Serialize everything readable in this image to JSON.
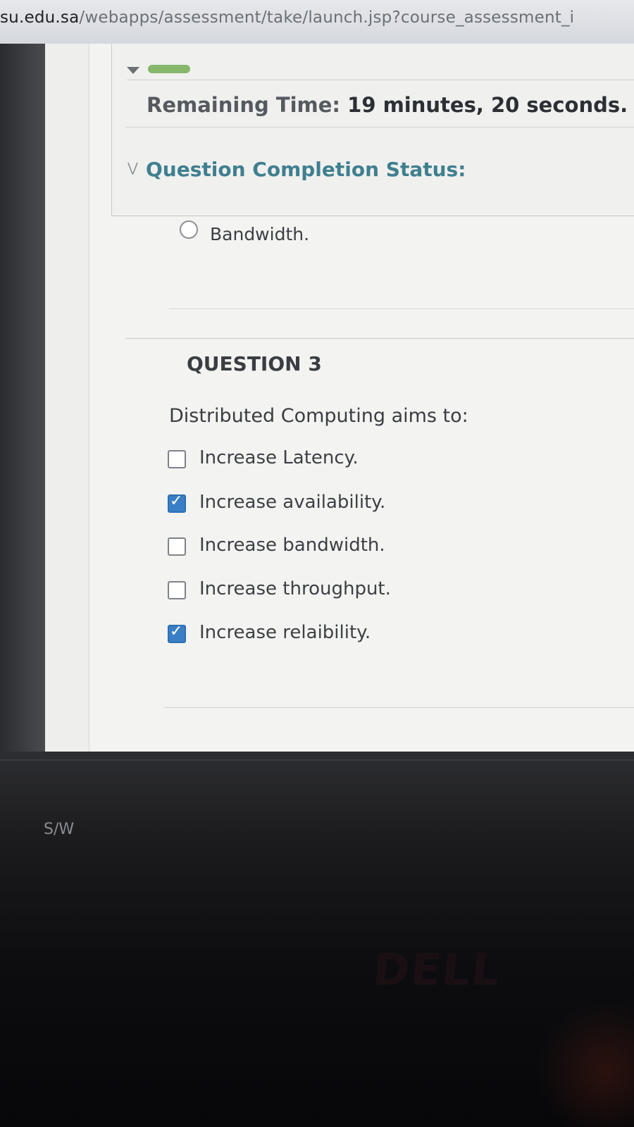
{
  "browser": {
    "url_host": "su.edu.sa",
    "url_path": "/webapps/assessment/take/launch.jsp?course_assessment_i"
  },
  "timer": {
    "label": "Remaining Time:",
    "value": "19 minutes, 20 seconds."
  },
  "status": {
    "label": "Question Completion Status:"
  },
  "previous_question": {
    "last_option": "Bandwidth."
  },
  "question": {
    "title": "QUESTION 3",
    "text": "Distributed Computing aims to:",
    "options": [
      {
        "label": "Increase Latency.",
        "checked": false
      },
      {
        "label": "Increase availability.",
        "checked": true
      },
      {
        "label": "Increase bandwidth.",
        "checked": false
      },
      {
        "label": "Increase throughput.",
        "checked": false
      },
      {
        "label": "Increase relaibility.",
        "checked": true
      }
    ]
  },
  "device": {
    "bezel_label": "S/W",
    "brand": "DELL"
  },
  "colors": {
    "accent": "#3f7f90",
    "checkbox_checked": "#3a7fc6",
    "progress": "#86b76b"
  }
}
